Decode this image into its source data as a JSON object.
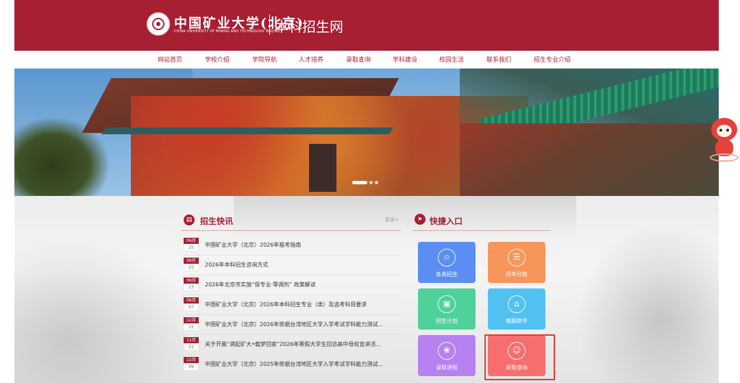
{
  "header": {
    "logo_cn": "中国矿业大学(北京)",
    "logo_en": "CHINA UNIVERSITY OF MINING AND TECHNOLOGY BEIJING",
    "site_name": "本科招生网",
    "bg_color": "#a61f33"
  },
  "nav": {
    "items": [
      {
        "label": "网站首页"
      },
      {
        "label": "学校介绍"
      },
      {
        "label": "学院导航"
      },
      {
        "label": "人才培养"
      },
      {
        "label": "录取查询"
      },
      {
        "label": "学科建设"
      },
      {
        "label": "校园生活"
      },
      {
        "label": "联系我们"
      },
      {
        "label": "招生专业介绍"
      }
    ]
  },
  "banner": {
    "slide_count": 3,
    "active_slide": 1
  },
  "news": {
    "title": "招生快讯",
    "more": "更多>",
    "items": [
      {
        "month": "06月",
        "day": "25",
        "text": "中国矿业大学（北京）2026年报考指南"
      },
      {
        "month": "06月",
        "day": "25",
        "text": "2026年本科招生咨询方式"
      },
      {
        "month": "06月",
        "day": "23",
        "text": "2026年北京市实施“保专业·零调剂” 政策解读"
      },
      {
        "month": "06月",
        "day": "07",
        "text": "中国矿业大学（北京）2026年本科招生专业（类）及选考科目要求"
      },
      {
        "month": "12月",
        "day": "15",
        "text": "中国矿业大学（北京）2026年依据台湾地区大学入学考试学科能力测试..."
      },
      {
        "month": "11月",
        "day": "21",
        "text": "关于开展“溯起矿大•载梦回家”2026年寒假大学生回访高中母校宣讲活..."
      },
      {
        "month": "12月",
        "day": "09",
        "text": "中国矿业大学（北京）2025年依据台湾地区大学入学考试学科能力测试..."
      }
    ]
  },
  "quick": {
    "title": "快捷入口",
    "tiles": [
      {
        "label": "各类招生",
        "icon": "bell-icon",
        "color": "#5b8ef0"
      },
      {
        "label": "历年分数",
        "icon": "clipboard-icon",
        "color": "#f7965a"
      },
      {
        "label": "招生计划",
        "icon": "box-icon",
        "color": "#4fd19a"
      },
      {
        "label": "填报助手",
        "icon": "building-icon",
        "color": "#51c1f2"
      },
      {
        "label": "录取进程",
        "icon": "flower-icon",
        "color": "#b681f0"
      },
      {
        "label": "录取查询",
        "icon": "people-icon",
        "color": "#f76e6e"
      }
    ]
  },
  "mascot": {
    "color": "#e8403a"
  }
}
